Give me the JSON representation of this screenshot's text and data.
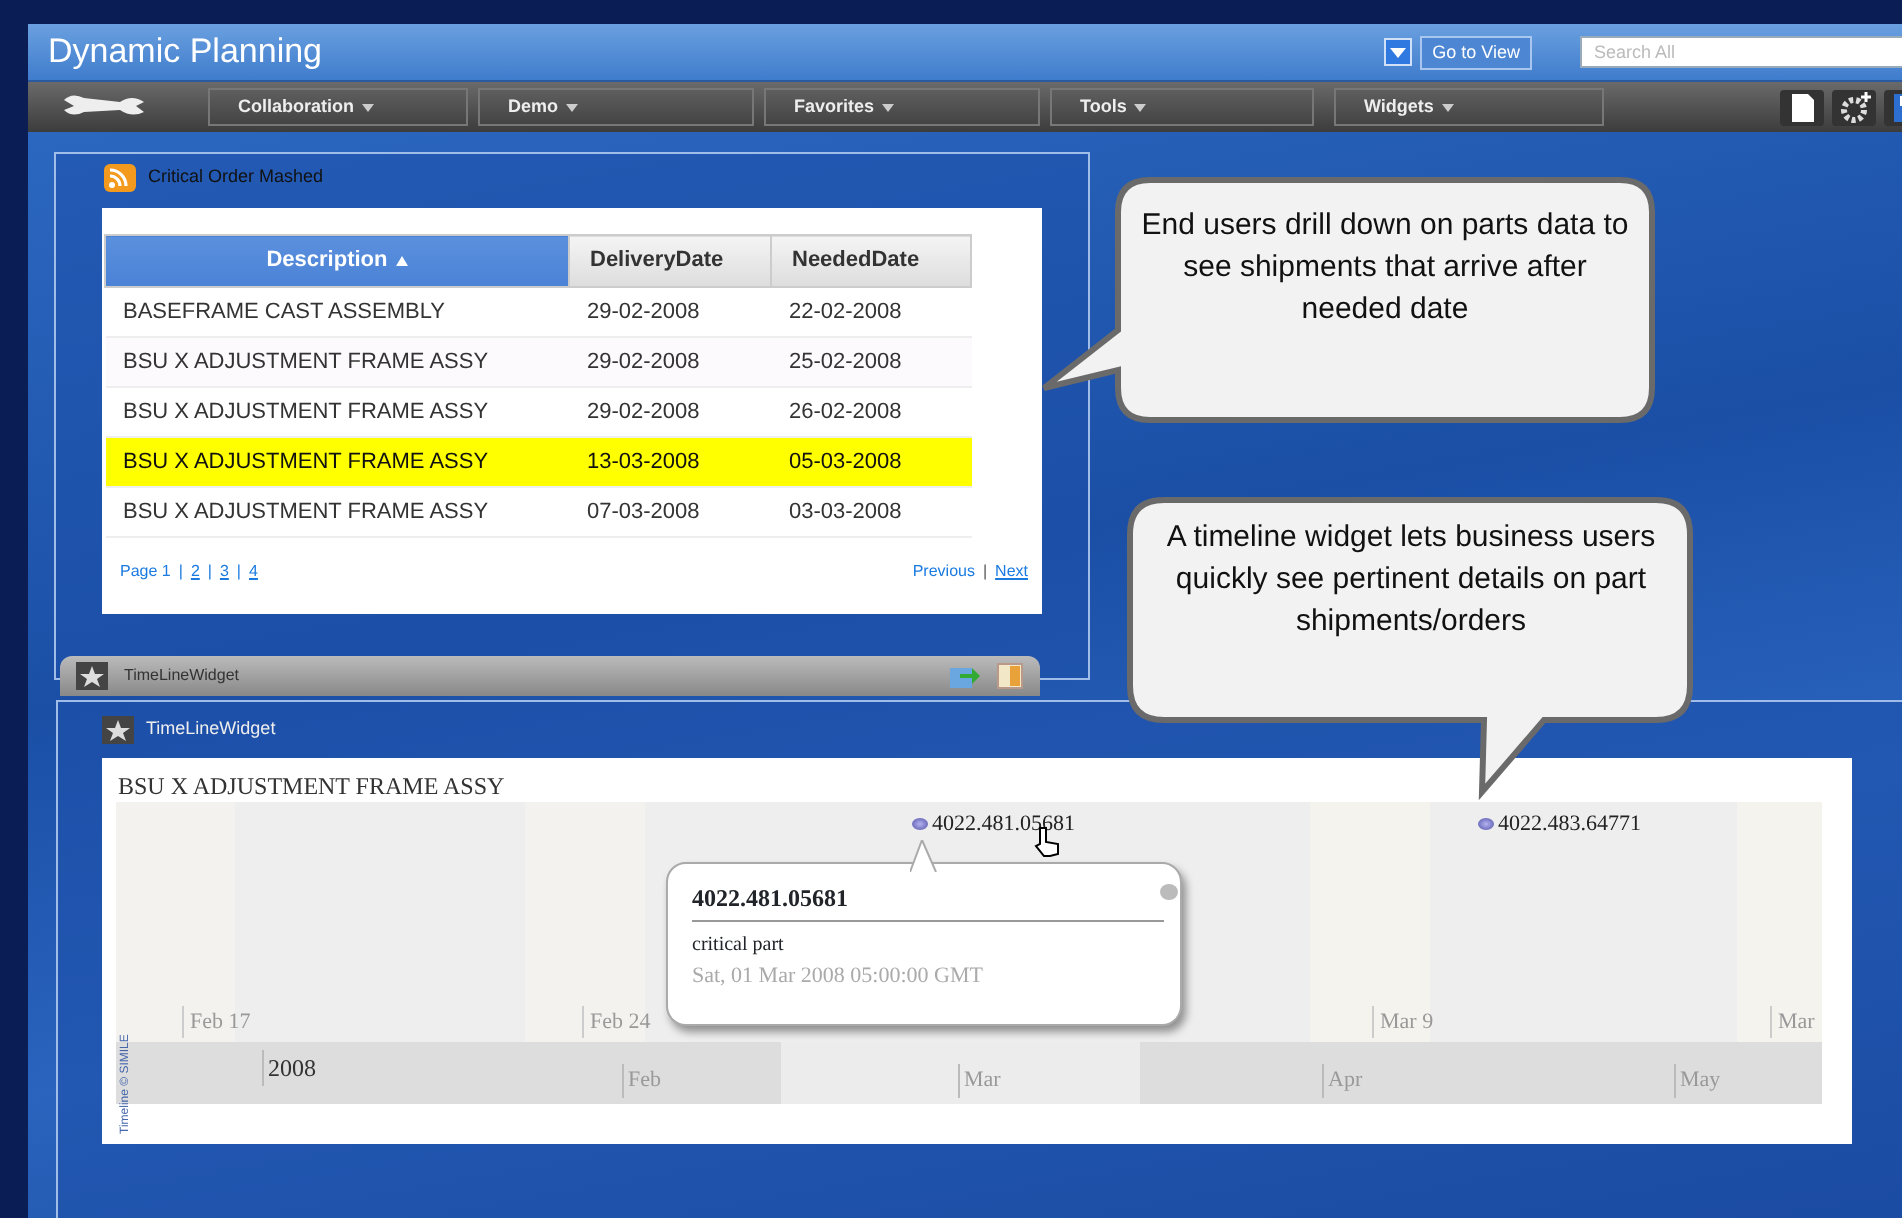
{
  "window": {
    "title": "Dynamic Planning"
  },
  "header": {
    "view_button": "Go to View",
    "search": {
      "placeholder": "Search All"
    }
  },
  "menu": [
    {
      "label": "Collaboration"
    },
    {
      "label": "Demo"
    },
    {
      "label": "Favorites"
    },
    {
      "label": "Tools"
    },
    {
      "label": "Widgets"
    }
  ],
  "orders_widget": {
    "title": "Critical Order Mashed",
    "columns": [
      {
        "label": "Description",
        "sorted": true
      },
      {
        "label": "DeliveryDate",
        "sorted": false
      },
      {
        "label": "NeededDate",
        "sorted": false
      }
    ],
    "rows": [
      {
        "cells": [
          "BASEFRAME CAST ASSEMBLY",
          "29-02-2008",
          "22-02-2008"
        ],
        "highlighted": false
      },
      {
        "cells": [
          "BSU X ADJUSTMENT FRAME ASSY",
          "29-02-2008",
          "25-02-2008"
        ],
        "highlighted": false
      },
      {
        "cells": [
          "BSU X ADJUSTMENT FRAME ASSY",
          "29-02-2008",
          "26-02-2008"
        ],
        "highlighted": false
      },
      {
        "cells": [
          "BSU X ADJUSTMENT FRAME ASSY",
          "13-03-2008",
          "05-03-2008"
        ],
        "highlighted": true
      },
      {
        "cells": [
          "BSU X ADJUSTMENT FRAME ASSY",
          "07-03-2008",
          "03-03-2008"
        ],
        "highlighted": false
      }
    ],
    "pager": {
      "separator": "|",
      "pages": [
        {
          "label": "Page 1",
          "selected": true
        },
        {
          "label": "2",
          "selected": false
        },
        {
          "label": "3",
          "selected": false
        },
        {
          "label": "4",
          "selected": false
        }
      ],
      "previous": {
        "label": "Previous",
        "disabled": true
      },
      "next": {
        "label": "Next",
        "disabled": false
      }
    }
  },
  "back_tab": {
    "title": "TimeLineWidget"
  },
  "timeline_widget": {
    "title": "TimeLineWidget",
    "heading": "BSU X ADJUSTMENT FRAME ASSY",
    "events": [
      {
        "label": "4022.481.05681"
      },
      {
        "label": "4022.483.64771"
      }
    ],
    "popup": {
      "title": "4022.481.05681",
      "description": "critical part",
      "date": "Sat, 01 Mar 2008 05:00:00 GMT"
    },
    "upper_scale": [
      "Feb 17",
      "Feb 24",
      "Mar 9",
      "Mar"
    ],
    "lower_scale": [
      "2008",
      "Feb",
      "Mar",
      "Apr",
      "May"
    ],
    "credit": "Timeline © SIMILE"
  },
  "callouts": [
    {
      "text": "End users drill down on parts data to see shipments that arrive after needed date"
    },
    {
      "text": "A timeline widget lets business users quickly see pertinent details on part shipments/orders"
    }
  ]
}
